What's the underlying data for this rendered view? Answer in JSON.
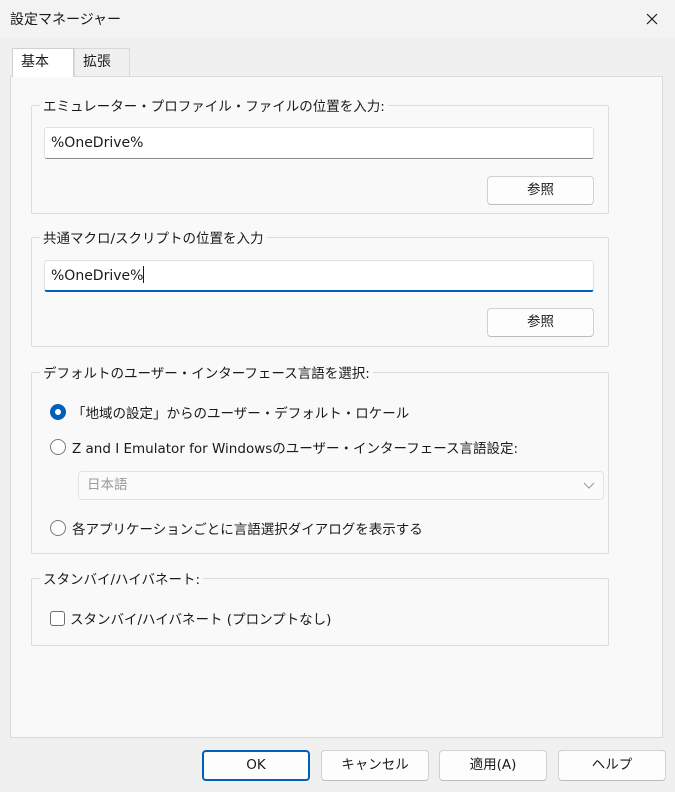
{
  "window": {
    "title": "設定マネージャー"
  },
  "tabs": [
    {
      "label": "基本",
      "active": true
    },
    {
      "label": "拡張",
      "active": false
    }
  ],
  "profile_location": {
    "label": "エミュレーター・プロファイル・ファイルの位置を入力:",
    "value": "%OneDrive%",
    "browse_label": "参照"
  },
  "macro_location": {
    "label": "共通マクロ/スクリプトの位置を入力",
    "value": "%OneDrive%",
    "browse_label": "参照"
  },
  "ui_language": {
    "label": "デフォルトのユーザー・インターフェース言語を選択:",
    "options": [
      {
        "label": "「地域の設定」からのユーザー・デフォルト・ロケール",
        "checked": true
      },
      {
        "label": "Z and I Emulator for Windowsのユーザー・インターフェース言語設定:",
        "checked": false
      },
      {
        "label": "各アプリケーションごとに言語選択ダイアログを表示する",
        "checked": false
      }
    ],
    "language_select_value": "日本語"
  },
  "standby": {
    "label": "スタンバイ/ハイバネート:",
    "checkbox_label": "スタンバイ/ハイバネート (プロンプトなし)",
    "checked": false
  },
  "buttons": {
    "ok": "OK",
    "cancel": "キャンセル",
    "apply": "適用(A)",
    "help": "ヘルプ"
  },
  "colors": {
    "accent": "#005fb8",
    "panel": "#f9f9f9",
    "window": "#f0f0f0"
  }
}
